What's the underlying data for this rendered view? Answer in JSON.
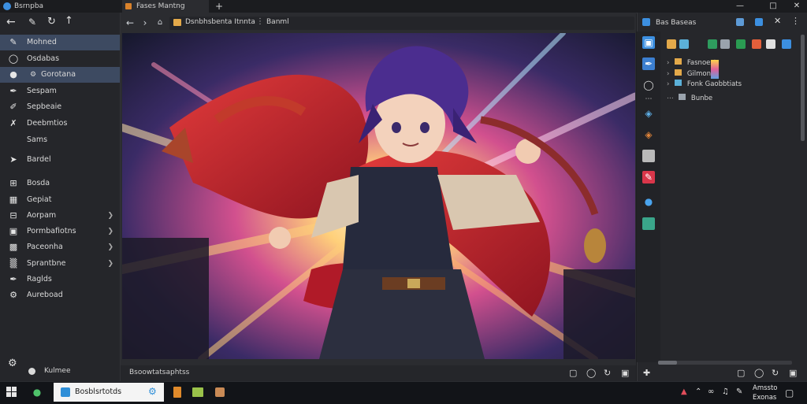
{
  "window": {
    "title": "Bsrnpba",
    "controls": [
      "minimize-icon",
      "maximize-icon",
      "close-icon"
    ]
  },
  "tabs": [
    {
      "label": "Fases Mantng",
      "active": true
    },
    {
      "label": "+"
    }
  ],
  "toolbar": {
    "breadcrumb_part1": "Dsnbhsbenta Itnnta",
    "breadcrumb_part2": "Banml"
  },
  "sidebar": {
    "items": [
      {
        "label": "Mohned",
        "icon": "pen-icon",
        "active": true
      },
      {
        "label": "Osdabas",
        "icon": "circle-icon"
      },
      {
        "label": "Gorotana",
        "icon": "chat-icon",
        "active": true
      },
      {
        "label": "Sespam",
        "icon": "brush-icon"
      },
      {
        "label": "Sepbeaie",
        "icon": "pencil-icon"
      },
      {
        "label": "Deebmtios",
        "icon": "wrench-icon"
      },
      {
        "label": "Sams",
        "icon": ""
      },
      {
        "label": "Bardel",
        "icon": "pin-icon"
      },
      {
        "label": "Bosda",
        "icon": "grid-icon"
      },
      {
        "label": "Gepiat",
        "icon": "layers-icon"
      },
      {
        "label": "Aorpam",
        "icon": "tree-icon",
        "chevron": true
      },
      {
        "label": "Pormbafiotns",
        "icon": "folder-icon",
        "chevron": true
      },
      {
        "label": "Paceonha",
        "icon": "box-icon",
        "chevron": true
      },
      {
        "label": "Sprantbne",
        "icon": "puzzle-icon",
        "chevron": true
      },
      {
        "label": "Raglds",
        "icon": "brush-icon"
      },
      {
        "label": "Aureboad",
        "icon": "gear-icon"
      }
    ],
    "footer_label": "Kulmee"
  },
  "status": {
    "main": "Bsoowtatsaphtss"
  },
  "right_panel": {
    "title": "Bas Baseas",
    "tree": [
      "Fasnoest",
      "Gilmon",
      "Fonk Gaobbtiats",
      "Bunbe"
    ]
  },
  "taskbar": {
    "pinned_app": "Bosblsrtotds",
    "clock_time": "Amssto",
    "clock_date": "Exonas"
  },
  "colors": {
    "accent_selected": "#3d4a61",
    "titlebar": "#1b1c1f",
    "sidebar": "#25262a"
  }
}
